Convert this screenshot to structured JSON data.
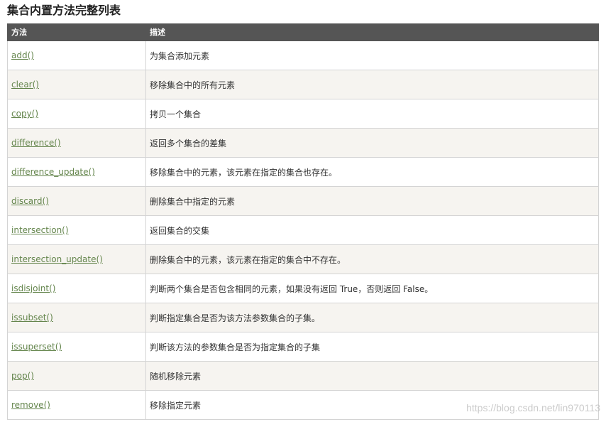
{
  "title": "集合内置方法完整列表",
  "table": {
    "headers": [
      "方法",
      "描述"
    ],
    "rows": [
      {
        "method": "add()",
        "desc": "为集合添加元素"
      },
      {
        "method": "clear()",
        "desc": "移除集合中的所有元素"
      },
      {
        "method": "copy()",
        "desc": "拷贝一个集合"
      },
      {
        "method": "difference()",
        "desc": "返回多个集合的差集"
      },
      {
        "method": "difference_update()",
        "desc": "移除集合中的元素，该元素在指定的集合也存在。"
      },
      {
        "method": "discard()",
        "desc": "删除集合中指定的元素"
      },
      {
        "method": "intersection()",
        "desc": "返回集合的交集"
      },
      {
        "method": "intersection_update()",
        "desc": "删除集合中的元素，该元素在指定的集合中不存在。"
      },
      {
        "method": "isdisjoint()",
        "desc": "判断两个集合是否包含相同的元素，如果没有返回 True，否则返回 False。"
      },
      {
        "method": "issubset()",
        "desc": "判断指定集合是否为该方法参数集合的子集。"
      },
      {
        "method": "issuperset()",
        "desc": "判断该方法的参数集合是否为指定集合的子集"
      },
      {
        "method": "pop()",
        "desc": "随机移除元素"
      },
      {
        "method": "remove()",
        "desc": "移除指定元素"
      }
    ]
  },
  "watermark": "https://blog.csdn.net/lin970113",
  "colors": {
    "header_bg": "#555555",
    "link": "#64854c",
    "row_alt_bg": "#f6f4f0"
  }
}
